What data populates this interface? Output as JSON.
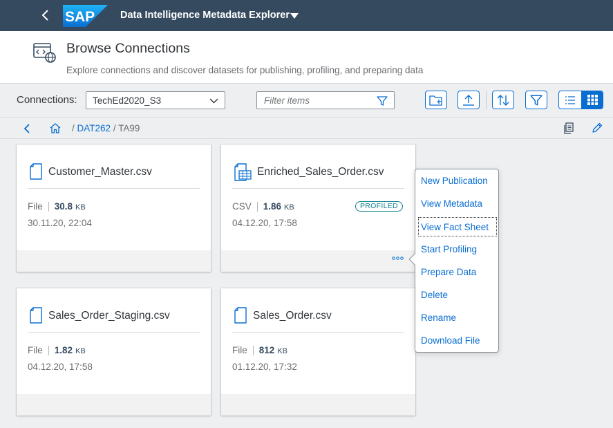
{
  "shell": {
    "logo_text": "SAP",
    "app_title": "Data Intelligence Metadata Explorer"
  },
  "header": {
    "title": "Browse Connections",
    "subtitle": "Explore connections and discover datasets for publishing, profiling, and preparing data"
  },
  "toolbar": {
    "connections_label": "Connections:",
    "connection_value": "TechEd2020_S3",
    "filter_placeholder": "Filter items"
  },
  "breadcrumb": {
    "sep1": "/",
    "folder": "DAT262",
    "sep2": "/",
    "current": "TA99"
  },
  "cards": [
    {
      "name": "Customer_Master.csv",
      "type": "File",
      "size": "30.8",
      "unit": "KB",
      "date": "30.11.20, 22:04"
    },
    {
      "name": "Enriched_Sales_Order.csv",
      "type": "CSV",
      "size": "1.86",
      "unit": "KB",
      "date": "04.12.20, 17:58",
      "badge": "PROFILED"
    },
    {
      "name": "Sales_Order_Staging.csv",
      "type": "File",
      "size": "1.82",
      "unit": "KB",
      "date": "04.12.20, 17:58"
    },
    {
      "name": "Sales_Order.csv",
      "type": "File",
      "size": "812",
      "unit": "KB",
      "date": "01.12.20, 17:32"
    }
  ],
  "menu": {
    "items": [
      "New Publication",
      "View Metadata",
      "View Fact Sheet",
      "Start Profiling",
      "Prepare Data",
      "Delete",
      "Rename",
      "Download File"
    ]
  },
  "colors": {
    "shell": "#354a5f",
    "accent": "#0a6ed1",
    "badge": "#0f828f",
    "background": "#edeff0"
  }
}
